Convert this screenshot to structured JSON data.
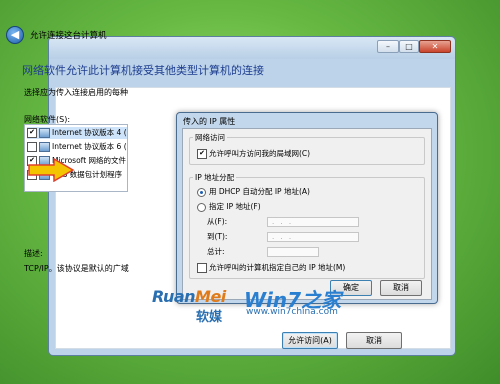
{
  "window": {
    "title": "允许连接这台计算机",
    "minimize_glyph": "–",
    "maximize_glyph": "□",
    "close_glyph": "✕",
    "back_glyph": "◀",
    "heading": "网络软件允许此计算机接受其他类型计算机的连接",
    "instruction": "选择应为传入连接启用的每种",
    "list_label": "网络软件(S):",
    "list_items": [
      {
        "label": "Internet 协议版本 4 (",
        "checked": true,
        "selected": true
      },
      {
        "label": "Internet 协议版本 6 (",
        "checked": false,
        "selected": false
      },
      {
        "label": "Microsoft 网络的文件",
        "checked": true,
        "selected": false
      },
      {
        "label": "QoS 数据包计划程序",
        "checked": true,
        "selected": false
      }
    ],
    "desc_label": "描述:",
    "desc_text": "TCP/IP。该协议是默认的广域",
    "allow_button": "允许访问(A)",
    "cancel_button": "取消"
  },
  "dialog": {
    "title": "传入的 IP 属性",
    "network_access_group": "网络访问",
    "allow_lan_label": "允许呼叫方访问我的局域网(C)",
    "allow_lan_checked": true,
    "ip_assign_group": "IP 地址分配",
    "dhcp_label": "用 DHCP 自动分配 IP 地址(A)",
    "specify_label": "指定 IP 地址(F)",
    "from_label": "从(F):",
    "to_label": "到(T):",
    "total_label": "总计:",
    "ip_placeholder": ". . .",
    "caller_ip_label": "允许呼叫的计算机指定自己的 IP 地址(M)",
    "caller_ip_checked": false,
    "ok_button": "确定",
    "cancel_button": "取消"
  },
  "watermark": {
    "brand_a": "Ruan",
    "brand_b": "Mei",
    "brand_cn": "软媒",
    "win7": "Win7之家",
    "url": "www.win7china.com"
  },
  "colors": {
    "desktop": "#66b842",
    "heading": "#1e3d8f",
    "arrow": "#f5c400",
    "accent": "#2a6fb0"
  }
}
